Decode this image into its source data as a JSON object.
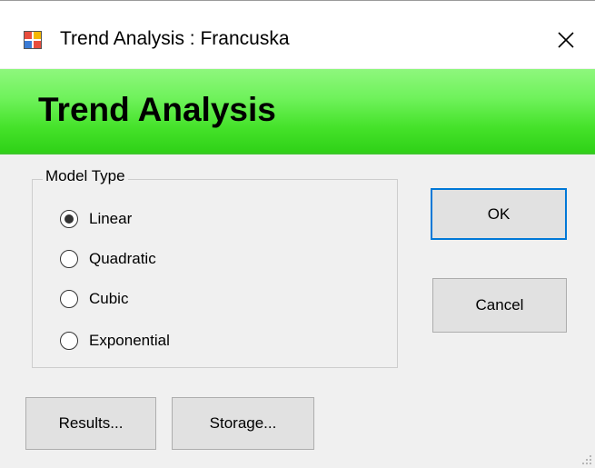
{
  "window": {
    "title": "Trend Analysis : Francuska",
    "close_glyph": "✕",
    "icon": "app-window-icon"
  },
  "banner": {
    "title": "Trend Analysis"
  },
  "model_type": {
    "legend": "Model Type",
    "options": [
      {
        "label": "Linear",
        "selected": true
      },
      {
        "label": "Quadratic",
        "selected": false
      },
      {
        "label": "Cubic",
        "selected": false
      },
      {
        "label": "Exponential",
        "selected": false
      }
    ]
  },
  "buttons": {
    "ok": "OK",
    "cancel": "Cancel",
    "results": "Results...",
    "storage": "Storage..."
  },
  "colors": {
    "banner_green": "#45e22a",
    "default_button_border": "#0078d7"
  }
}
